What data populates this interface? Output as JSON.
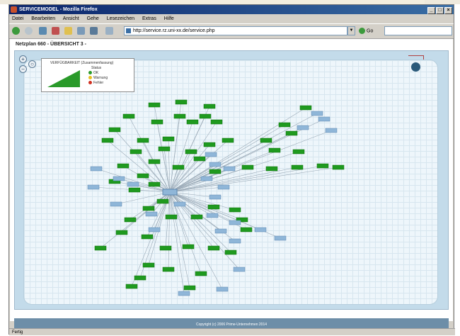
{
  "window": {
    "title": "SERVICEMODEL - Mozilla Firefox"
  },
  "menu": [
    "Datei",
    "Bearbeiten",
    "Ansicht",
    "Gehe",
    "Lesezeichen",
    "Extras",
    "Hilfe"
  ],
  "toolbar": {
    "url": "http://service.rz.uni-xx.de/service.php",
    "go_label": "Go"
  },
  "page": {
    "title": "Netzplan 660 - ÜBERSICHT 3 -"
  },
  "legend": {
    "title": "VERFÜGBARKEIT (Zusammenfassung)",
    "subtitle": "Status",
    "items": [
      {
        "label": "OK",
        "color": "#2a9a2a"
      },
      {
        "label": "Warnung",
        "color": "#e8c020"
      },
      {
        "label": "Fehler",
        "color": "#d03020"
      }
    ]
  },
  "footer": {
    "copyright": "Copyright (c) 2006 Prime-Unternehmen 2014"
  },
  "statusbar": {
    "text": "Fertig"
  },
  "colors": {
    "node_ok": "#1f9a1f",
    "node_service": "#8fb6d8",
    "edge": "#9aa9b6",
    "title_bar": "#0a246a",
    "canvas_bg": "#eef6fb"
  }
}
